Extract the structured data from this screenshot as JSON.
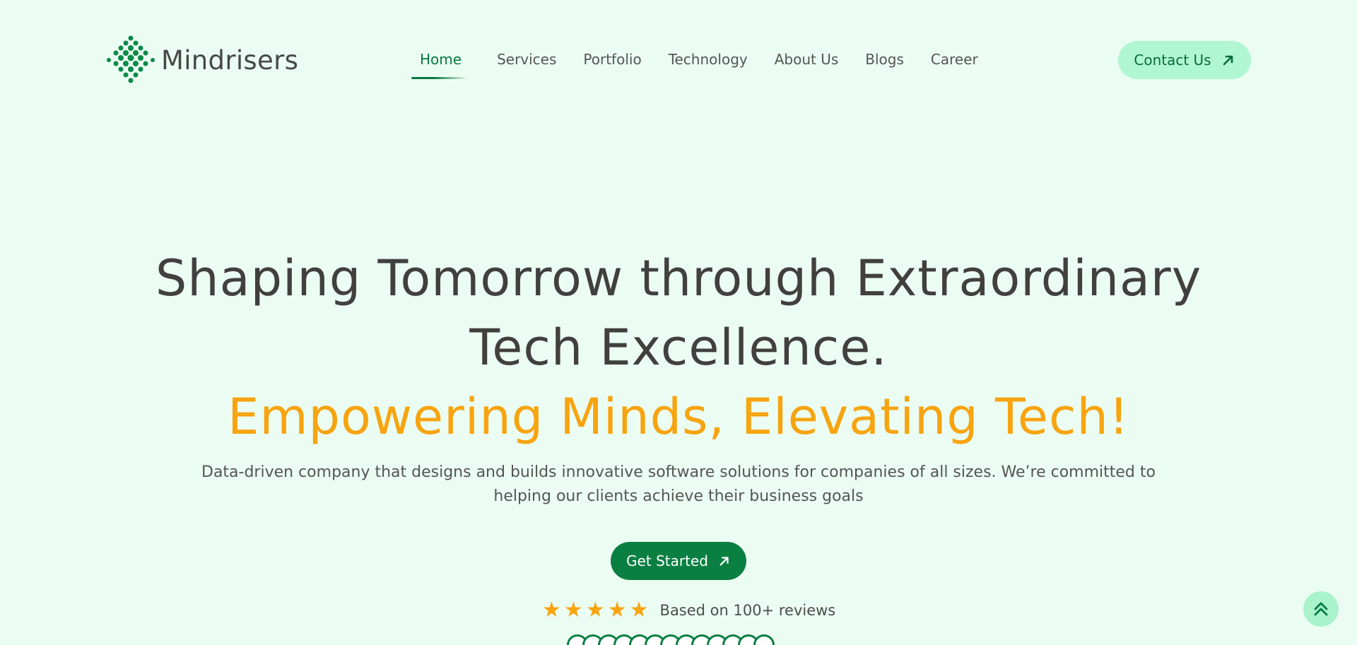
{
  "brand": {
    "name": "Mindrisers",
    "accent": "#0a7f42",
    "highlight": "#f7a410",
    "background": "#ebfdf2"
  },
  "nav": {
    "items": [
      {
        "label": "Home",
        "active": true
      },
      {
        "label": "Services"
      },
      {
        "label": "Portfolio"
      },
      {
        "label": "Technology"
      },
      {
        "label": "About Us"
      },
      {
        "label": "Blogs"
      },
      {
        "label": "Career"
      }
    ],
    "contact_label": "Contact Us"
  },
  "hero": {
    "title_line1": "Shaping Tomorrow through Extraordinary",
    "title_line2": "Tech Excellence.",
    "tagline": "Empowering Minds, Elevating Tech!",
    "description": "Data-driven company that designs and builds innovative software solutions for companies of all sizes. We’re committed to helping our clients achieve their business goals",
    "cta_label": "Get Started",
    "rating": 5,
    "reviews_text": "Based on 100+ reviews"
  },
  "icons": {
    "logo": "dot-grid-logo-icon",
    "arrow": "arrow-up-right-icon",
    "star": "star-icon",
    "scroll_top": "double-chevron-up-icon"
  }
}
